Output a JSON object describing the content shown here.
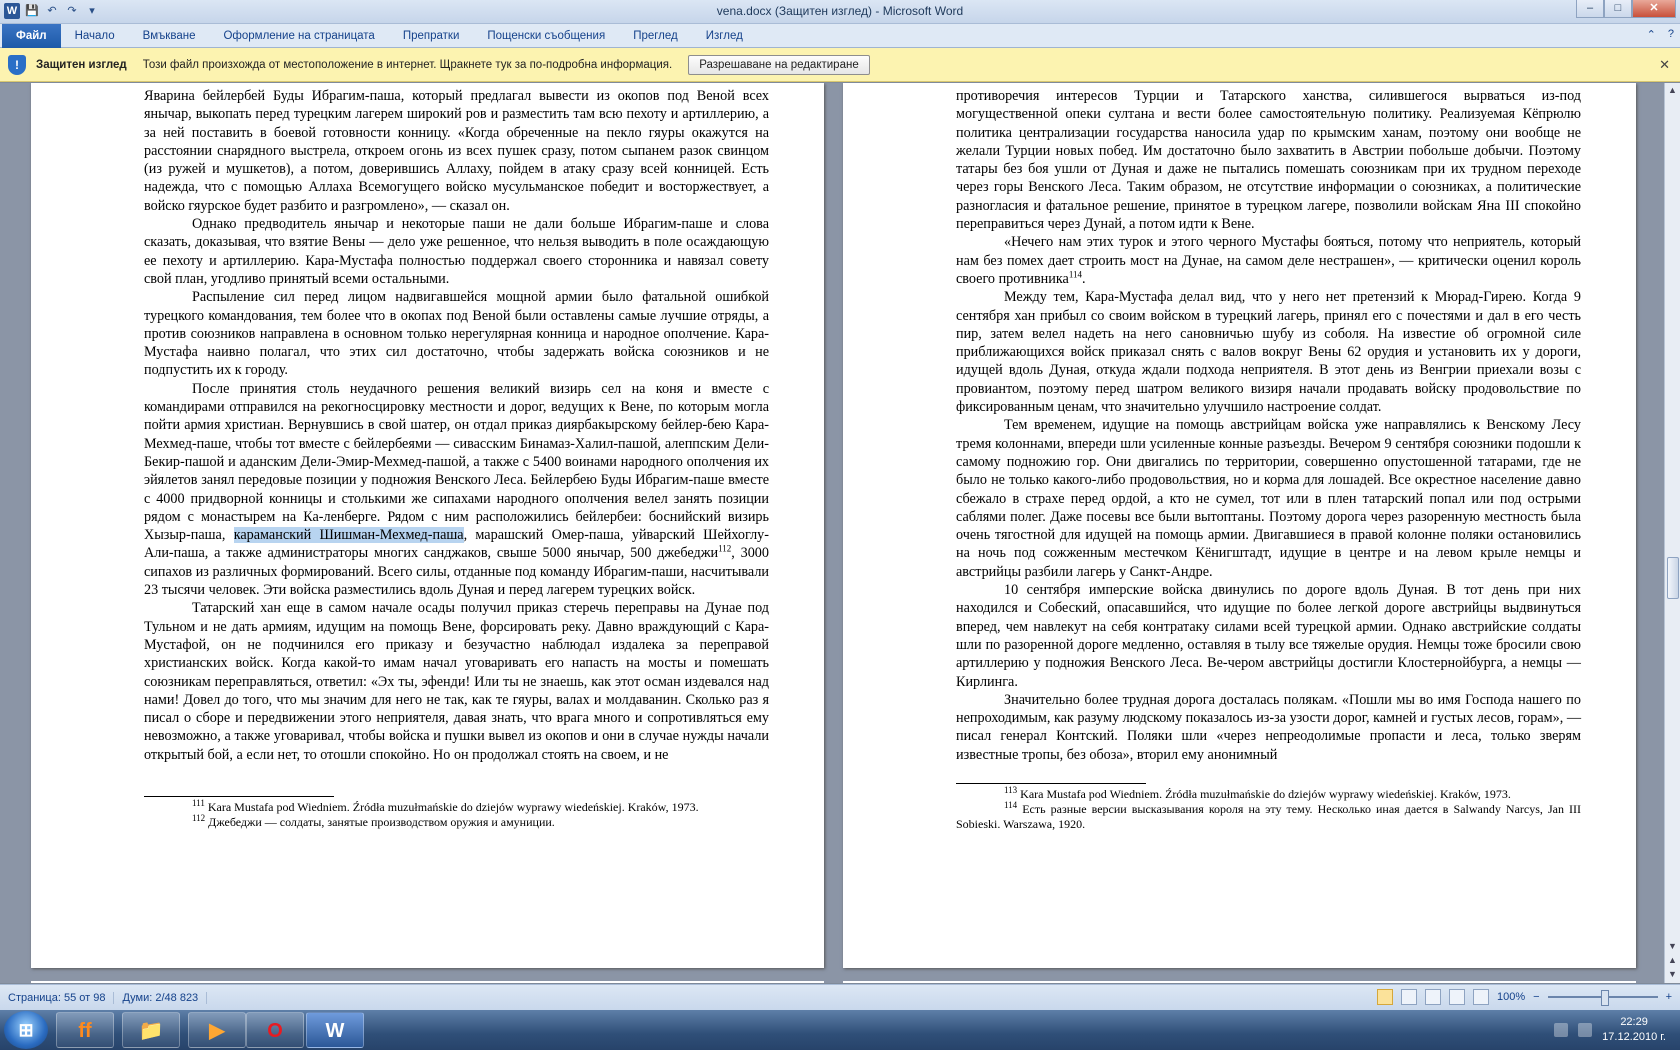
{
  "window": {
    "title": "vena.docx (Защитен изглед)  -  Microsoft Word",
    "buttons": {
      "minimize": "–",
      "maximize": "□",
      "close": "✕"
    }
  },
  "qat": {
    "app_icon": "W",
    "save": "💾",
    "undo": "↶",
    "redo": "↷",
    "customize": "▾"
  },
  "ribbon": {
    "tabs": [
      "Файл",
      "Начало",
      "Вмъкване",
      "Оформление на страницата",
      "Препратки",
      "Пощенски съобщения",
      "Преглед",
      "Изглед"
    ],
    "right": {
      "minimize_ribbon": "⌃",
      "help": "?"
    }
  },
  "protected_view": {
    "icon": "!",
    "title": "Защитен изглед",
    "message": "Този файл произхожда от местоположение в интернет. Щракнете тук за по-подробна информация.",
    "button": "Разрешаване на редактиране",
    "close": "✕"
  },
  "page1": {
    "p1": "Яварина бейлербей Буды Ибрагим-паша, который предлагал вывести из окопов под Веной всех янычар, выкопать перед турецким лагерем широкий ров и разместить там всю пехоту и артиллерию, а за ней поставить в боевой готовности конницу. «Когда обреченные на пекло гяуры окажутся на расстоянии снарядного выстрела, откроем огонь из всех пушек сразу, потом сыпанем разок свинцом (из ружей и мушкетов), а потом, доверившись Аллаху, пойдем в атаку сразу всей конницей. Есть надежда, что с помощью Аллаха Всемогущего войско мусульманское победит и восторжествует, а войско гяурское будет разбито и разгромлено», — сказал он.",
    "p2": "Однако предводитель янычар и некоторые паши не дали больше Ибрагим-паше и слова сказать, доказывая, что взятие Вены — дело уже решенное, что нельзя выводить в поле осаждающую ее пехоту и артиллерию. Кара-Мустафа полностью поддержал своего сторонника и навязал совету свой план, угодливо принятый всеми остальными.",
    "p3": "Распыление сил перед лицом надвигавшейся мощной армии было фатальной ошибкой турецкого командования, тем более что в окопах под Веной были оставлены самые лучшие отряды, а против союзников направлена в основном только нерегулярная конница и народное ополчение. Кара-Мустафа наивно полагал, что этих сил достаточно, чтобы задержать войска союзников и не подпустить их к городу.",
    "p4_a": "После принятия столь неудачного решения великий визирь сел на коня и вместе с командирами отправился на рекогносцировку местности и дорог, ведущих к Вене, по которым могла пойти армия христиан. Вернувшись в свой шатер, он отдал приказ диярбакырскому бейлер-бею Кара-Мехмед-паше, чтобы тот вместе с бейлербеями — сивасским Бинамаз-Халил-пашой, алеппским Дели-Бекир-пашой и аданским Дели-Эмир-Мехмед-пашой, а также с 5400 воинами народного ополчения их эйялетов занял передовые позиции у подножия Венского Леса. Бейлербею Буды Ибрагим-паше вместе с 4000 придворной конницы и столькими же сипахами народного ополчения велел занять позиции рядом с монастырем на Ка-ленберге. Рядом с ним расположились бейлербеи: боснийский визирь Хызыр-паша, ",
    "p4_hl": "караманский Шишман-Мехмед-паша",
    "p4_b": ", марашский Омер-паша, уйварский Шейхоглу-Али-паша, а также администраторы многих санджаков, свыше 5000 янычар, 500 джебеджи",
    "p4_sup": "112",
    "p4_c": ", 3000 сипахов из различных формирований. Всего силы, отданные под команду Ибрагим-паши, насчитывали 23 тысячи человек. Эти войска разместились вдоль Дуная и перед лагерем турецких войск.",
    "p5": "Татарский хан еще в самом начале осады получил приказ стеречь переправы на Дунае под Тульном и не дать армиям, идущим на помощь Вене, форсировать реку. Давно враждующий с Кара-Мустафой, он не подчинился его приказу и безучастно наблюдал издалека за переправой христианских войск. Когда какой-то имам начал уговаривать его напасть на мосты и помешать союзникам переправляться, ответил: «Эх ты, эфенди! Или ты не знаешь, как этот осман издевался над нами! Довел до того, что мы значим для него не так, как те гяуры, валах и молдаванин. Сколько раз я писал о сборе и передвижении этого неприятеля, давая знать, что врага много и сопротивляться ему невозможно, а также уговаривал, чтобы войска и пушки вывел из окопов и они в случае нужды начали открытый бой, а если нет, то отошли спокойно. Но он продолжал стоять на своем, и не",
    "fn1_num": "111",
    "fn1": " Kara Mustafa pod Wiedniem. Źródła muzułmańskie do dziejów wyprawy wiedeńskiej.  Kraków, 1973.",
    "fn2_num": "112",
    "fn2": " Джебеджи — солдаты, занятые производством оружия и амуниции."
  },
  "page2": {
    "p1": "противоречия интересов Турции и Татарского ханства, силившегося вырваться из-под могущественной опеки султана и вести более самостоятельную политику. Реализуемая Кёпрюлю политика централизации государства наносила удар по крымским ханам, поэтому они вообще не желали Турции новых побед. Им достаточно было захватить в Австрии побольше добычи. Поэтому татары без боя ушли от Дуная и даже не пытались помешать союзникам при их трудном переходе через горы Венского Леса. Таким образом, не отсутствие информации о союзниках, а политические разногласия и фатальное решение, принятое в турецком лагере, позволили войскам Яна III спокойно переправиться через Дунай, а потом идти к Вене.",
    "p2_a": "«Нечего нам этих турок и этого черного Мустафы бояться, потому что неприятель, который нам без помех дает строить мост на Дунае, на самом деле нестрашен», — критически оценил король своего противника",
    "p2_sup": "114",
    "p2_b": ".",
    "p3": "Между тем, Кара-Мустафа делал вид, что у него нет претензий к Мюрад-Гирею. Когда 9 сентября хан прибыл со своим войском в турецкий лагерь, принял его с почестями и дал в его честь пир, затем велел надеть на него сановничью шубу из соболя. На известие об огромной силе приближающихся войск приказал снять с валов вокруг Вены 62 орудия и установить их у дороги, идущей вдоль Дуная, откуда ждали подхода неприятеля. В этот день из Венгрии приехали возы с провиантом, поэтому перед шатром великого визиря начали продавать войску продовольствие по фиксированным ценам, что значительно улучшило настроение солдат.",
    "p4": "Тем временем, идущие на помощь австрийцам войска уже направлялись к Венскому Лесу тремя колоннами, впереди шли усиленные конные разъезды. Вечером 9 сентября союзники подошли к самому подножию гор. Они двигались по территории, совершенно опустошенной татарами, где не было не только какого-либо продовольствия, но и корма для лошадей. Все окрестное население давно сбежало в страхе перед ордой, а кто не сумел, тот или в плен татарский попал или под острыми саблями полег. Даже посевы все были вытоптаны. Поэтому дорога через разоренную местность была очень тягостной для идущей на помощь армии. Двигавшиеся в правой колонне поляки остановились на ночь под сожженным местечком Кёнигштадт, идущие в центре и на левом крыле немцы и австрийцы разбили лагерь у Санкт-Андре.",
    "p5": "10 сентября имперские войска двинулись по дороге вдоль Дуная. В тот день при них находился и Собеский, опасавшийся, что идущие по более легкой дороге австрийцы выдвинуться вперед, чем навлекут на себя контратаку силами всей турецкой армии. Однако австрийские солдаты шли по разоренной дороге медленно, оставляя в тылу все тяжелые орудия. Немцы тоже бросили свою артиллерию у подножия Венского Леса. Ве-чером австрийцы достигли Клостернойбурга, а немцы — Кирлинга.",
    "p6": "Значительно более трудная дорога досталась полякам. «Пошли мы во имя Господа нашего по непроходимым, как разуму людскому показалось из-за узости дорог, камней и густых лесов, горам», — писал генерал Контский. Поляки шли «через непреодолимые пропасти и леса, только зверям известные тропы, без обоза», вторил ему анонимный",
    "fn1_num": "113",
    "fn1": " Kara Mustafa pod Wiedniem. Źródła muzułmańskie do dziejów wyprawy wiedeńskiej. Kraków, 1973.",
    "fn2_num": "114",
    "fn2": " Есть разные версии высказывания короля на эту тему. Несколько иная дается в Salwandy Narcys, Jan III Sobieski. Warszawa, 1920."
  },
  "status": {
    "page": "Страница: 55 от 98",
    "words": "Думи: 2/48 823",
    "zoom": "100%",
    "zoom_minus": "−",
    "zoom_plus": "+"
  },
  "taskbar": {
    "start": "⊞",
    "apps": {
      "firefox": "ff",
      "explorer": "📁",
      "media": "▶",
      "opera": "O",
      "word": "W"
    },
    "time": "22:29",
    "date": "17.12.2010 г."
  }
}
